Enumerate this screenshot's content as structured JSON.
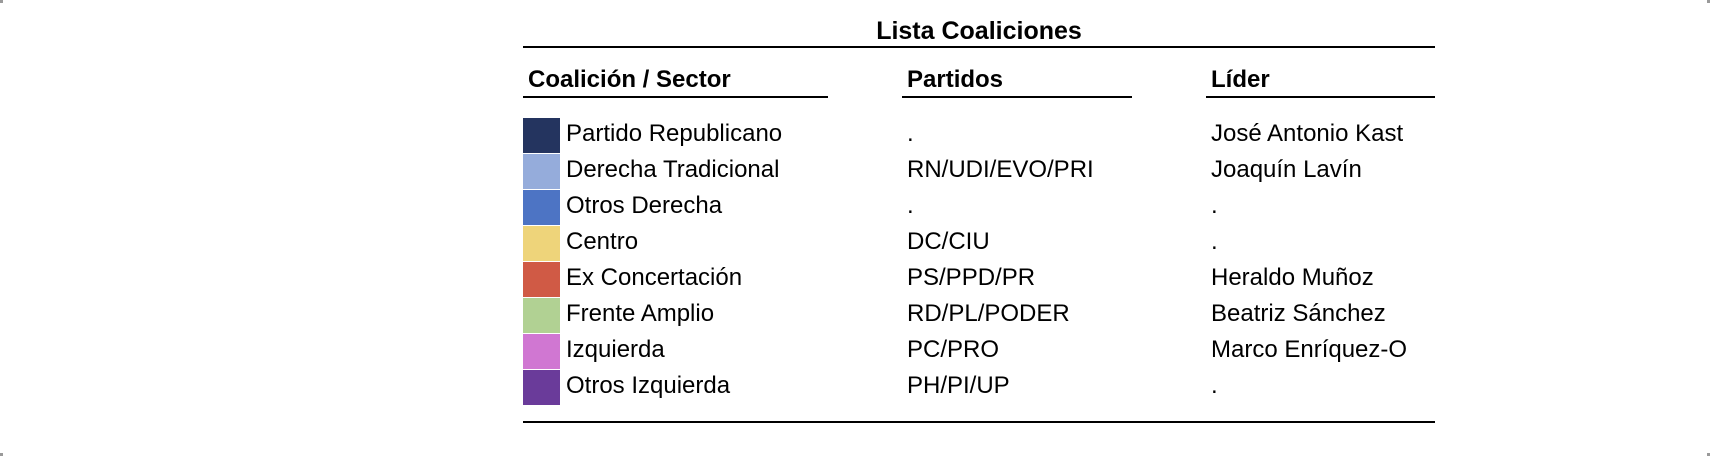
{
  "title": "Lista Coaliciones",
  "headers": {
    "coalition": "Coalición / Sector",
    "parties": "Partidos",
    "leader": "Líder"
  },
  "rows": [
    {
      "name": "Partido Republicano",
      "parties": ".",
      "leader": "José Antonio Kast",
      "color": "#24345f"
    },
    {
      "name": "Derecha Tradicional",
      "parties": "RN/UDI/EVO/PRI",
      "leader": "Joaquín Lavín",
      "color": "#95acdb"
    },
    {
      "name": "Otros Derecha",
      "parties": ".",
      "leader": ".",
      "color": "#4d74c4"
    },
    {
      "name": "Centro",
      "parties": "DC/CIU",
      "leader": ".",
      "color": "#eed47a"
    },
    {
      "name": "Ex Concertación",
      "parties": "PS/PPD/PR",
      "leader": "Heraldo Muñoz",
      "color": "#d05a45"
    },
    {
      "name": "Frente Amplio",
      "parties": "RD/PL/PODER",
      "leader": "Beatriz Sánchez",
      "color": "#b1d193"
    },
    {
      "name": "Izquierda",
      "parties": "PC/PRO",
      "leader": "Marco Enríquez-O",
      "color": "#d077d2"
    },
    {
      "name": "Otros Izquierda",
      "parties": "PH/PI/UP",
      "leader": ".",
      "color": "#6a3b9a"
    }
  ]
}
